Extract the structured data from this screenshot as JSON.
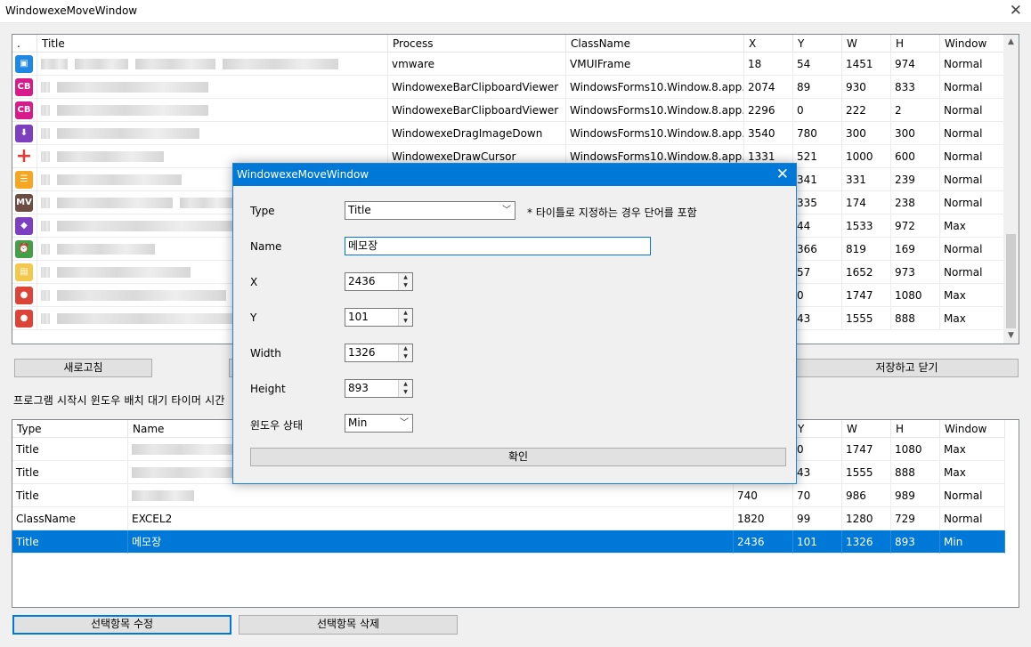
{
  "window": {
    "title": "WindowexeMoveWindow",
    "close": "✕"
  },
  "top_list": {
    "columns": [
      ".",
      "Title",
      "Process",
      "ClassName",
      "X",
      "Y",
      "W",
      "H",
      "Window"
    ],
    "rows": [
      {
        "icon": "vmware-icon",
        "color": "#1e88e5",
        "glyph": "▣",
        "process": "vmware",
        "class": "VMUIFrame",
        "x": "18",
        "y": "54",
        "w": "1451",
        "h": "974",
        "window": "Normal"
      },
      {
        "icon": "clipboard-viewer-icon",
        "color": "#d81b8a",
        "glyph": "CB",
        "process": "WindowexeBarClipboardViewer",
        "class": "WindowsForms10.Window.8.app...",
        "x": "2074",
        "y": "89",
        "w": "930",
        "h": "833",
        "window": "Normal"
      },
      {
        "icon": "clipboard-viewer-icon",
        "color": "#d81b8a",
        "glyph": "CB",
        "process": "WindowexeBarClipboardViewer",
        "class": "WindowsForms10.Window.8.app...",
        "x": "2296",
        "y": "0",
        "w": "222",
        "h": "2",
        "window": "Normal"
      },
      {
        "icon": "drag-image-down-icon",
        "color": "#7e3fbf",
        "glyph": "⬇",
        "process": "WindowexeDragImageDown",
        "class": "WindowsForms10.Window.8.app...",
        "x": "3540",
        "y": "780",
        "w": "300",
        "h": "300",
        "window": "Normal"
      },
      {
        "icon": "draw-cursor-icon",
        "color": "#ffffff",
        "glyph": "+",
        "process": "WindowexeDrawCursor",
        "class": "WindowsForms10.Window.8.app...",
        "x": "1331",
        "y": "521",
        "w": "1000",
        "h": "600",
        "window": "Normal"
      },
      {
        "icon": "app-icon",
        "color": "#f5a623",
        "glyph": "☰",
        "process": "",
        "class": "",
        "x": "",
        "y": "341",
        "w": "331",
        "h": "239",
        "window": "Normal"
      },
      {
        "icon": "mv-icon",
        "color": "#6d4c41",
        "glyph": "MV",
        "process": "",
        "class": "",
        "x": "",
        "y": "335",
        "w": "174",
        "h": "238",
        "window": "Normal"
      },
      {
        "icon": "visual-studio-icon",
        "color": "#7b3fbf",
        "glyph": "◆",
        "process": "",
        "class": "",
        "x": "",
        "y": "44",
        "w": "1533",
        "h": "972",
        "window": "Max"
      },
      {
        "icon": "alarm-clock-icon",
        "color": "#43a047",
        "glyph": "⏰",
        "process": "",
        "class": "",
        "x": "",
        "y": "366",
        "w": "819",
        "h": "169",
        "window": "Normal"
      },
      {
        "icon": "image-viewer-icon",
        "color": "#f2c94c",
        "glyph": "▤",
        "process": "",
        "class": "",
        "x": "",
        "y": "57",
        "w": "1652",
        "h": "973",
        "window": "Normal"
      },
      {
        "icon": "chrome-icon",
        "color": "#db4437",
        "glyph": "●",
        "process": "",
        "class": "",
        "x": "",
        "y": "0",
        "w": "1747",
        "h": "1080",
        "window": "Max"
      },
      {
        "icon": "chrome-icon",
        "color": "#db4437",
        "glyph": "●",
        "process": "",
        "class": "",
        "x": "",
        "y": "43",
        "w": "1555",
        "h": "888",
        "window": "Max"
      }
    ]
  },
  "buttons": {
    "refresh": "새로고침",
    "save_close": "저장하고 닫기",
    "edit_selected": "선택항목 수정",
    "delete_selected": "선택항목 삭제"
  },
  "startup_label": "프로그램 시작시 윈도우 배치 대기 타이머 시간",
  "bottom_list": {
    "columns": [
      "Type",
      "Name",
      "",
      "Y",
      "W",
      "H",
      "Window"
    ],
    "rows": [
      {
        "type": "Title",
        "name": "",
        "x": "",
        "y": "0",
        "w": "1747",
        "h": "1080",
        "window": "Max",
        "selected": false
      },
      {
        "type": "Title",
        "name": "",
        "x": "",
        "y": "43",
        "w": "1555",
        "h": "888",
        "window": "Max",
        "selected": false
      },
      {
        "type": "Title",
        "name": "",
        "x": "740",
        "y": "70",
        "w": "986",
        "h": "989",
        "window": "Normal",
        "selected": false
      },
      {
        "type": "ClassName",
        "name": "EXCEL2",
        "x": "1820",
        "y": "99",
        "w": "1280",
        "h": "729",
        "window": "Normal",
        "selected": false
      },
      {
        "type": "Title",
        "name": "메모장",
        "x": "2436",
        "y": "101",
        "w": "1326",
        "h": "893",
        "window": "Min",
        "selected": true
      }
    ]
  },
  "dialog": {
    "title": "WindowexeMoveWindow",
    "type_label": "Type",
    "type_value": "Title",
    "type_hint": "* 타이틀로 지정하는 경우 단어를 포함",
    "name_label": "Name",
    "name_value": "메모장",
    "x_label": "X",
    "x_value": "2436",
    "y_label": "Y",
    "y_value": "101",
    "width_label": "Width",
    "width_value": "1326",
    "height_label": "Height",
    "height_value": "893",
    "state_label": "윈도우 상태",
    "state_value": "Min",
    "ok_label": "확인"
  }
}
